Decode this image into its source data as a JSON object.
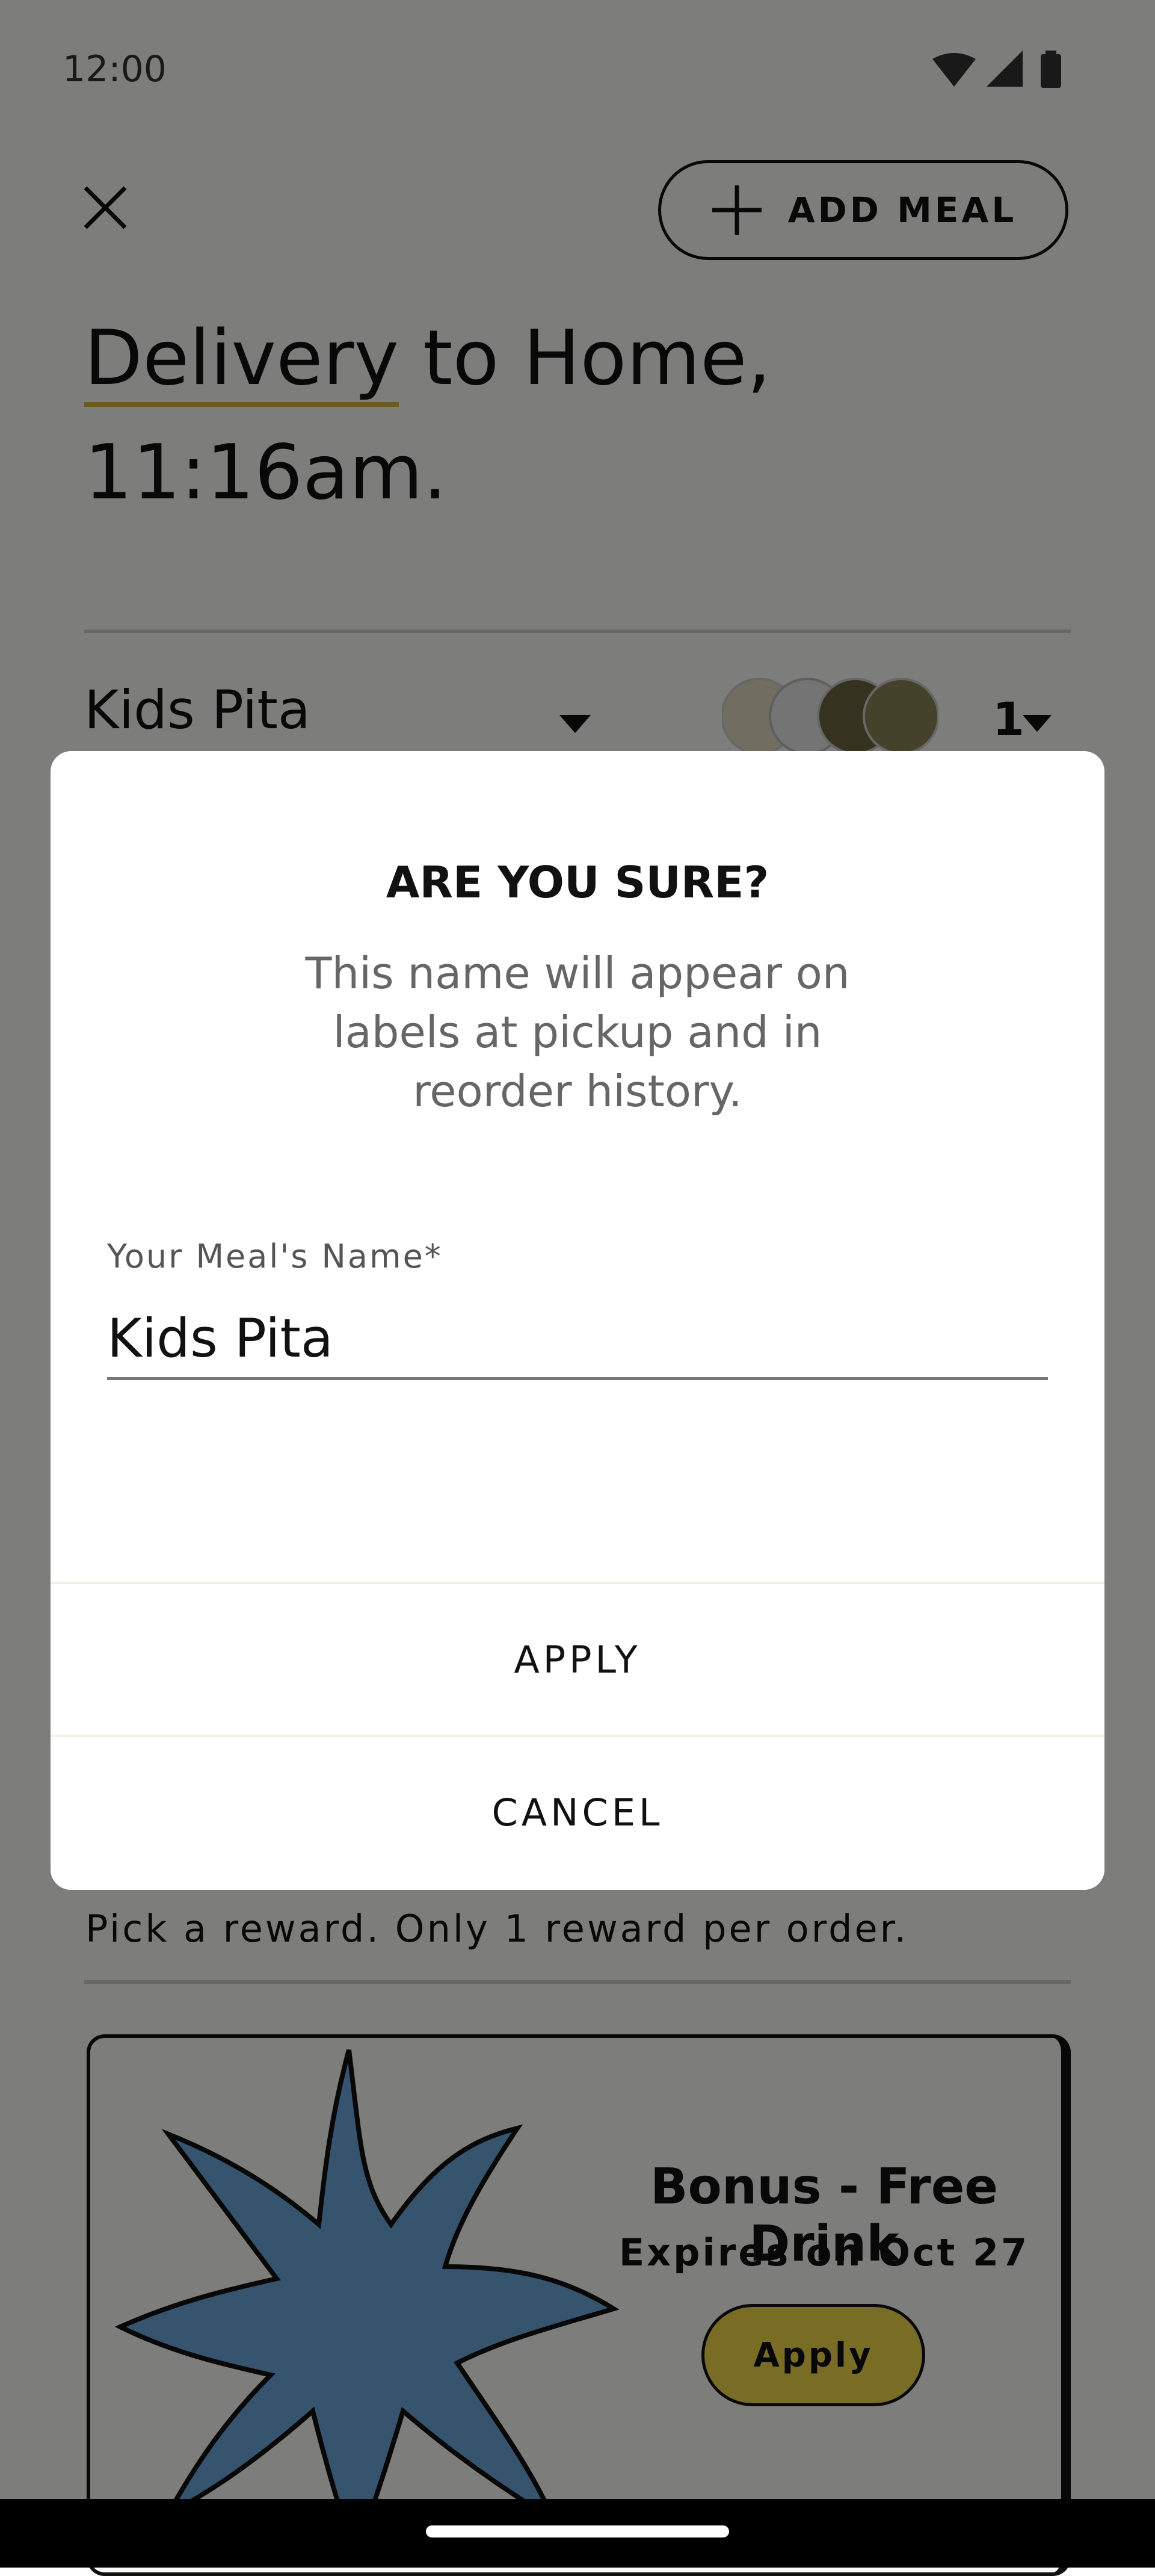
{
  "status_bar": {
    "time": "12:00",
    "icons": [
      "wifi-icon",
      "signal-icon",
      "battery-icon"
    ]
  },
  "header": {
    "close_icon": "close-icon",
    "add_meal_label": "ADD MEAL",
    "add_meal_icon": "plus-icon"
  },
  "delivery": {
    "mode": "Delivery",
    "destination": " to Home,",
    "time": "11:16am."
  },
  "meal": {
    "name": "Kids Pita",
    "quantity": "1"
  },
  "rewards": {
    "note": "Pick a reward. Only 1 reward per order.",
    "card": {
      "title": "Bonus - Free Drink",
      "expiry": "Expires on Oct 27",
      "apply_label": "Apply"
    }
  },
  "dialog": {
    "title": "ARE YOU SURE?",
    "body": "This name will appear on labels at pickup and in reorder history.",
    "field_label": "Your Meal's Name*",
    "field_value": "Kids Pita",
    "apply_label": "APPLY",
    "cancel_label": "CANCEL"
  },
  "colors": {
    "accent_yellow": "#f2d94b",
    "underline_gold": "#d8b24a",
    "burst_blue": "#6fa8dc",
    "scrim": "rgba(0,0,0,0.5)"
  }
}
